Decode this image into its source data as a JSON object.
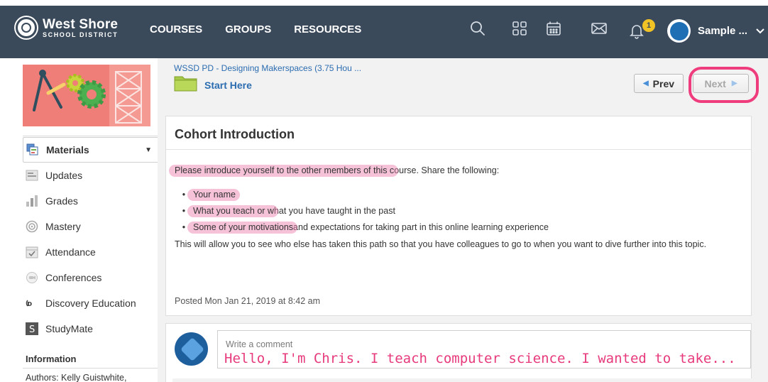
{
  "topnav": {
    "logo_line1": "West Shore",
    "logo_line2": "SCHOOL DISTRICT",
    "links": [
      "COURSES",
      "GROUPS",
      "RESOURCES"
    ],
    "notification_count": "1",
    "user_name": "Sample ..."
  },
  "sidebar": {
    "items": [
      {
        "label": "Materials",
        "icon": "materials-icon"
      },
      {
        "label": "Updates",
        "icon": "updates-icon"
      },
      {
        "label": "Grades",
        "icon": "grades-icon"
      },
      {
        "label": "Mastery",
        "icon": "mastery-icon"
      },
      {
        "label": "Attendance",
        "icon": "attendance-icon"
      },
      {
        "label": "Conferences",
        "icon": "conferences-icon"
      },
      {
        "label": "Discovery Education",
        "icon": "discovery-education-icon"
      },
      {
        "label": "StudyMate",
        "icon": "studymate-icon"
      }
    ],
    "info_title": "Information",
    "authors": "Authors: Kelly Guistwhite,"
  },
  "header": {
    "breadcrumb": "WSSD PD - Designing Makerspaces (3.75 Hou ...",
    "folder_title": "Start Here",
    "prev_label": "Prev",
    "next_label": "Next"
  },
  "content": {
    "title": "Cohort Introduction",
    "intro_hl": "Please introduce yourself to the other members of this c",
    "intro_rest": "ourse. Share the following:",
    "bullets": [
      {
        "hl": "Your name",
        "rest": ""
      },
      {
        "hl": "What you teach or w",
        "rest": "hat you have taught in the past"
      },
      {
        "hl": "Some of your motivations",
        "rest": " and expectations for taking part in this online learning experience"
      }
    ],
    "paragraph": "This will allow you to see who else has taken this path so that you have colleagues to go to when you want to dive further into this topic.",
    "posted": "Posted Mon Jan 21, 2019 at 8:42 am"
  },
  "comment": {
    "placeholder": "Write a comment",
    "typed_text": "Hello, I'm Chris. I teach computer science. I wanted to take..."
  },
  "colors": {
    "nav_bg": "#3a4a5b",
    "link_blue": "#2b6cb0",
    "highlight_pink": "#ef3c7c",
    "badge_yellow": "#f2c325"
  }
}
